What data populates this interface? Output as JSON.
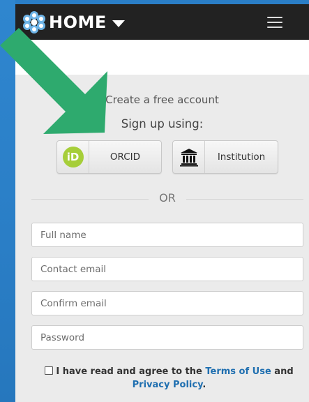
{
  "navbar": {
    "brand": "HOME"
  },
  "signup": {
    "heading": "Create a free account",
    "subheading": "Sign up using:",
    "orcid_label": "ORCID",
    "orcid_icon_text": "iD",
    "institution_label": "Institution",
    "divider": "OR"
  },
  "form": {
    "full_name_placeholder": "Full name",
    "contact_email_placeholder": "Contact email",
    "confirm_email_placeholder": "Confirm email",
    "password_placeholder": "Password"
  },
  "agreement": {
    "prefix": "I have read and agree to the ",
    "terms_link": "Terms of Use",
    "and": " and",
    "privacy_link": "Privacy Policy",
    "suffix": "."
  },
  "colors": {
    "frame_blue": "#2a7ec6",
    "navbar_bg": "#222222",
    "orcid_green": "#a6ce39",
    "arrow_green": "#2eaa6e",
    "link_blue": "#1f6fb0"
  },
  "icons": {
    "brand": "flower-logo-icon",
    "caret": "caret-down-icon",
    "menu": "hamburger-menu-icon",
    "orcid": "orcid-icon",
    "institution": "institution-building-icon",
    "arrow": "arrow-pointer-icon"
  }
}
